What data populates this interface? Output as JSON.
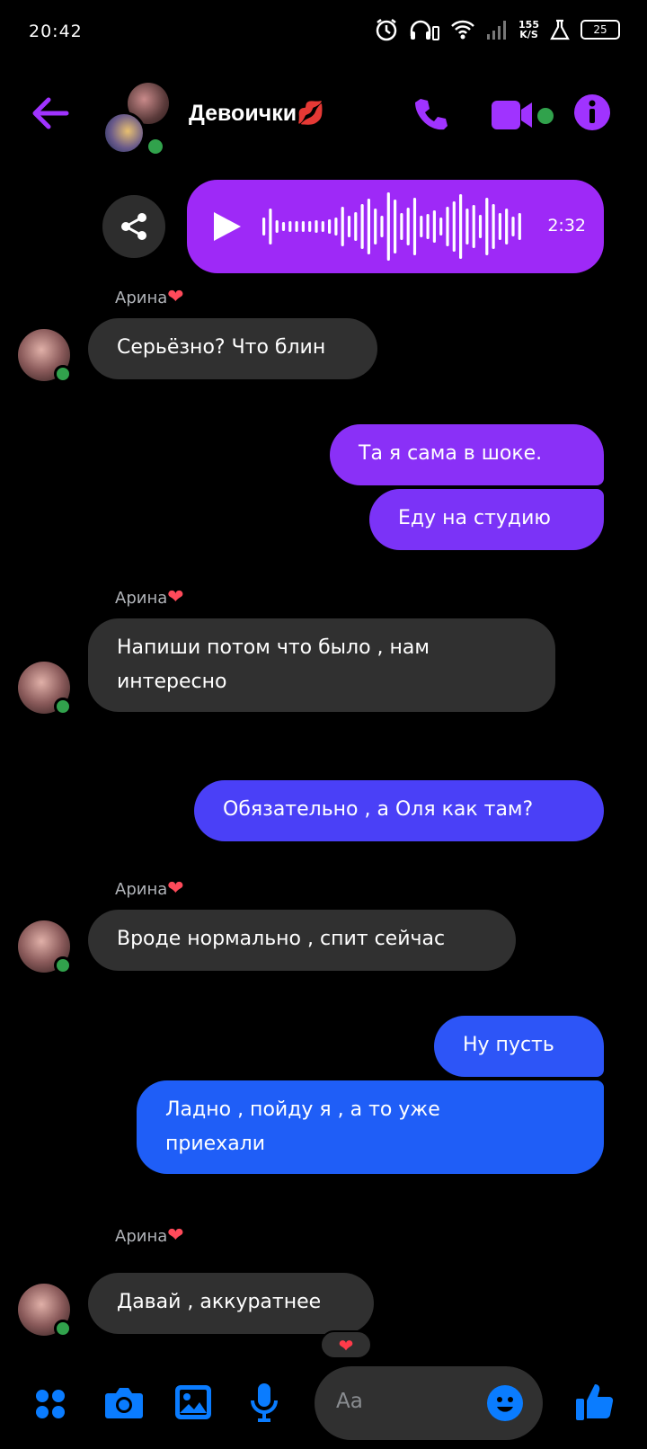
{
  "status": {
    "time": "20:42",
    "net_speed_top": "155",
    "net_speed_bottom": "K/S",
    "battery": "25"
  },
  "header": {
    "title": "Девоички💋"
  },
  "voice": {
    "duration": "2:32"
  },
  "messages": [
    {
      "dir": "in",
      "sender": "Арина",
      "text": "Серьёзно? Что блин"
    },
    {
      "dir": "out",
      "text": "Та я сама в шоке."
    },
    {
      "dir": "out",
      "text": "Еду на студию"
    },
    {
      "dir": "in",
      "sender": "Арина",
      "text": "Напиши потом что было , нам\nинтересно"
    },
    {
      "dir": "out",
      "text": "Обязательно , а Оля как там?"
    },
    {
      "dir": "in",
      "sender": "Арина",
      "text": "Вроде нормально , спит сейчас"
    },
    {
      "dir": "out",
      "text": "Ну пусть"
    },
    {
      "dir": "out",
      "text": "Ладно , пойду я , а то уже\nприехали"
    },
    {
      "dir": "in",
      "sender": "Арина",
      "text": "Давай , аккуратнее"
    }
  ],
  "reaction": "❤",
  "composer": {
    "placeholder": "Aa"
  },
  "colors": {
    "accent": "#a033ff",
    "voice_bubble": "#9e29f7",
    "incoming": "#303030",
    "online": "#31a24c",
    "toolbar_blue": "#0a7cff"
  }
}
